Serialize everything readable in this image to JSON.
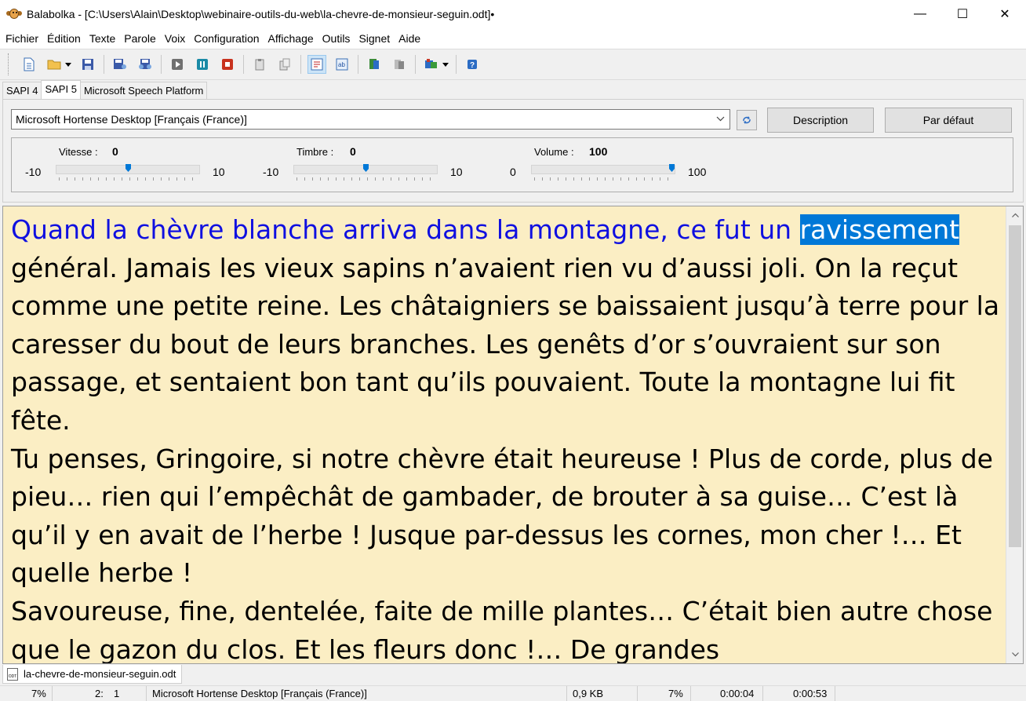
{
  "window": {
    "title": "Balabolka - [C:\\Users\\Alain\\Desktop\\webinaire-outils-du-web\\la-chevre-de-monsieur-seguin.odt]•",
    "minimize": "—",
    "maximize": "☐",
    "close": "✕"
  },
  "menu": [
    "Fichier",
    "Édition",
    "Texte",
    "Parole",
    "Voix",
    "Configuration",
    "Affichage",
    "Outils",
    "Signet",
    "Aide"
  ],
  "tabs": [
    "SAPI 4",
    "SAPI 5",
    "Microsoft Speech Platform"
  ],
  "active_tab": "SAPI 5",
  "voice": {
    "selected": "Microsoft Hortense Desktop [Français (France)]",
    "description_button": "Description",
    "default_button": "Par défaut"
  },
  "sliders": {
    "speed": {
      "label": "Vitesse :",
      "value": "0",
      "min": "-10",
      "max": "10",
      "fraction": 0.5
    },
    "pitch": {
      "label": "Timbre :",
      "value": "0",
      "min": "-10",
      "max": "10",
      "fraction": 0.5
    },
    "volume": {
      "label": "Volume :",
      "value": "100",
      "min": "0",
      "max": "100",
      "fraction": 1.0
    }
  },
  "editor": {
    "spoken_text": "Quand la chèvre blanche arriva dans la montagne, ce fut un ",
    "highlighted_word": "ravissement",
    "remaining_text": " général. Jamais les vieux sapins n’avaient rien vu d’aussi joli. On la reçut comme une petite reine. Les châtaigniers se baissaient jusqu’à terre pour la caresser du bout de leurs branches. Les genêts d’or s’ouvraient sur son passage, et sentaient bon tant qu’ils pouvaient. Toute la montagne lui fit fête.",
    "paragraph_2": "Tu penses, Gringoire, si notre chèvre était heureuse ! Plus de corde, plus de pieu… rien qui l’empêchât de gambader, de brouter à sa guise… C’est là qu’il y en avait de l’herbe ! Jusque par-dessus les cornes, mon cher !… Et quelle herbe !",
    "paragraph_3": "Savoureuse, fine, dentelée, faite de mille plantes… C’était bien autre chose que le gazon du clos. Et les fleurs donc !… De grandes"
  },
  "document_tab": {
    "filename": "la-chevre-de-monsieur-seguin.odt",
    "icon_text": "ODT"
  },
  "status": {
    "progress": "7%",
    "cursor_line": "2:",
    "cursor_col": "1",
    "voice": "Microsoft Hortense Desktop [Français (France)]",
    "size": "0,9 KB",
    "percent": "7%",
    "elapsed": "0:00:04",
    "total": "0:00:53"
  },
  "colors": {
    "editor_background": "#fbeec4",
    "spoken_text": "#1010e0",
    "selection": "#0078d7",
    "accent": "#0078d7"
  }
}
